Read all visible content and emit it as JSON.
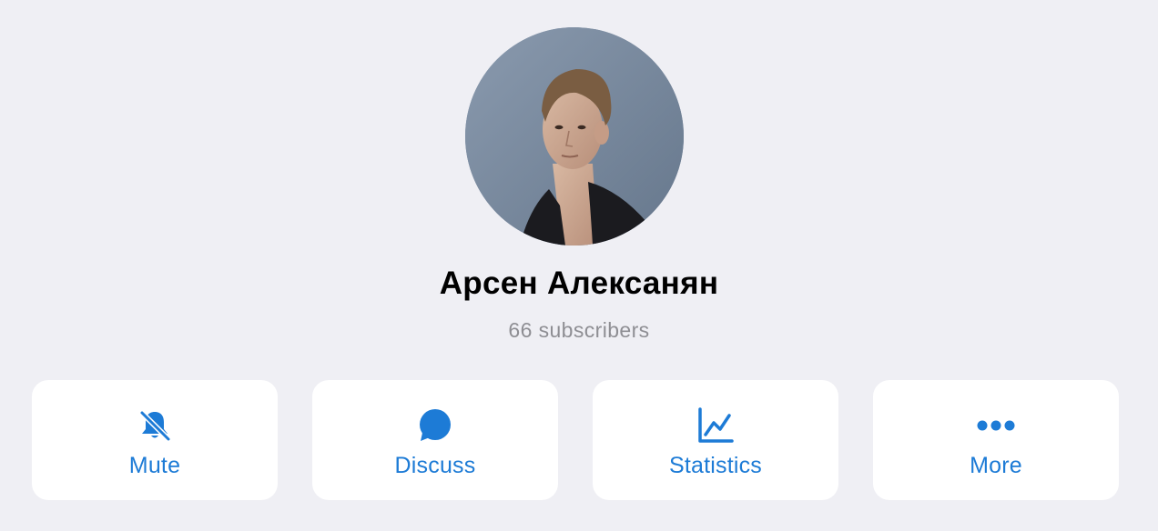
{
  "profile": {
    "name": "Арсен Алексанян",
    "subscribers": "66 subscribers"
  },
  "actions": [
    {
      "label": "Mute",
      "icon": "bell-muted-icon"
    },
    {
      "label": "Discuss",
      "icon": "chat-bubble-icon"
    },
    {
      "label": "Statistics",
      "icon": "chart-line-icon"
    },
    {
      "label": "More",
      "icon": "more-dots-icon"
    }
  ],
  "colors": {
    "background": "#efeff4",
    "card": "#ffffff",
    "accent": "#1d7bd6",
    "secondary_text": "#8e8e93"
  }
}
